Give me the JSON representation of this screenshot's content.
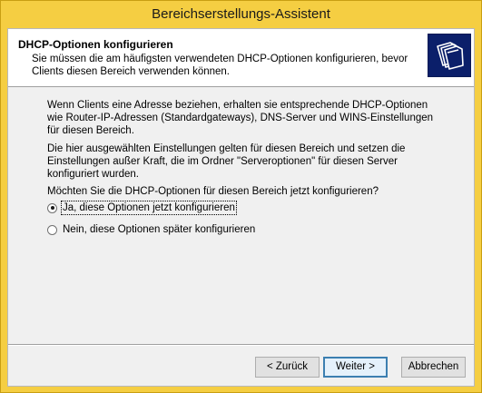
{
  "window": {
    "title": "Bereichserstellungs-Assistent"
  },
  "header": {
    "title": "DHCP-Optionen konfigurieren",
    "subtitle": "Sie müssen die am häufigsten verwendeten DHCP-Optionen konfigurieren, bevor Clients diesen Bereich verwenden können.",
    "icon": "folders-icon"
  },
  "content": {
    "paragraph1": "Wenn Clients eine Adresse beziehen, erhalten sie entsprechende DHCP-Optionen wie Router-IP-Adressen (Standardgateways), DNS-Server und WINS-Einstellungen für diesen Bereich.",
    "paragraph2": "Die hier ausgewählten Einstellungen gelten für diesen Bereich und setzen die Einstellungen außer Kraft, die im Ordner \"Serveroptionen\" für diesen Server konfiguriert wurden.",
    "question": "Möchten Sie die DHCP-Optionen für diesen Bereich jetzt konfigurieren?",
    "options": [
      {
        "label": "Ja, diese Optionen jetzt konfigurieren",
        "selected": true
      },
      {
        "label": "Nein, diese Optionen später konfigurieren",
        "selected": false
      }
    ]
  },
  "buttons": {
    "back": "< Zurück",
    "next": "Weiter >",
    "cancel": "Abbrechen"
  },
  "colors": {
    "titlebar": "#f5ce42",
    "dialog_bg": "#f0f0f0",
    "header_bg": "#ffffff",
    "icon_bg": "#0b1f6a"
  }
}
